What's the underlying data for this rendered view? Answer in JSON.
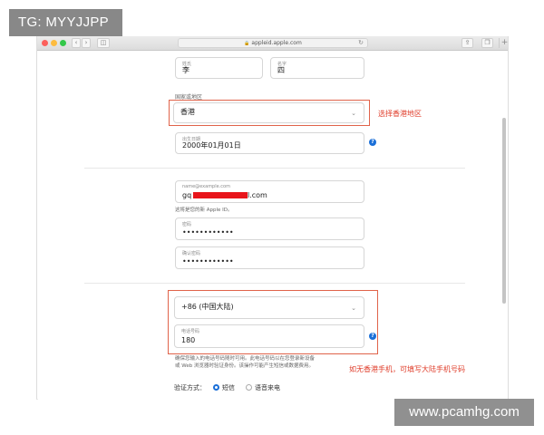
{
  "watermarks": {
    "top_left": "TG: MYYJJPP",
    "bottom_right": "www.pcamhg.com"
  },
  "browser": {
    "url": "appleid.apple.com",
    "lock_icon": "lock-icon",
    "reload_icon": "reload-icon"
  },
  "form": {
    "last_name": {
      "label": "姓氏",
      "value": "李"
    },
    "first_name": {
      "label": "名字",
      "value": "四"
    },
    "region": {
      "section_label": "国家或地区",
      "value": "香港"
    },
    "birthday": {
      "label": "出生日期",
      "value": "2000年01月01日"
    },
    "email": {
      "placeholder": "name@example.com",
      "value_prefix": "gq",
      "value_suffix": "l.com",
      "helper": "这将是您的新 Apple ID。"
    },
    "password": {
      "label": "密码",
      "value": "••••••••••••"
    },
    "confirm_password": {
      "label": "确认密码",
      "value": "••••••••••••"
    },
    "country_code": {
      "value": "+86 (中国大陆)"
    },
    "phone": {
      "label": "电话号码",
      "value": "180"
    },
    "phone_helper_line1": "确保您输入的电话号码随时可用。此电话号码以在您登录新设备",
    "phone_helper_line2": "或 Web 浏览器时验证身份。该操作可能产生短信或数据费用。",
    "verify": {
      "label": "验证方式：",
      "option_sms": "短信",
      "option_call": "语音来电",
      "selected": "短信"
    }
  },
  "annotations": {
    "select_hk": "选择香港地区",
    "mainland_phone": "如无香港手机，可填写大陆手机号码"
  },
  "colors": {
    "annotation_red": "#e0402e",
    "accent_blue": "#1a6fd8",
    "redaction": "#e8151b"
  }
}
